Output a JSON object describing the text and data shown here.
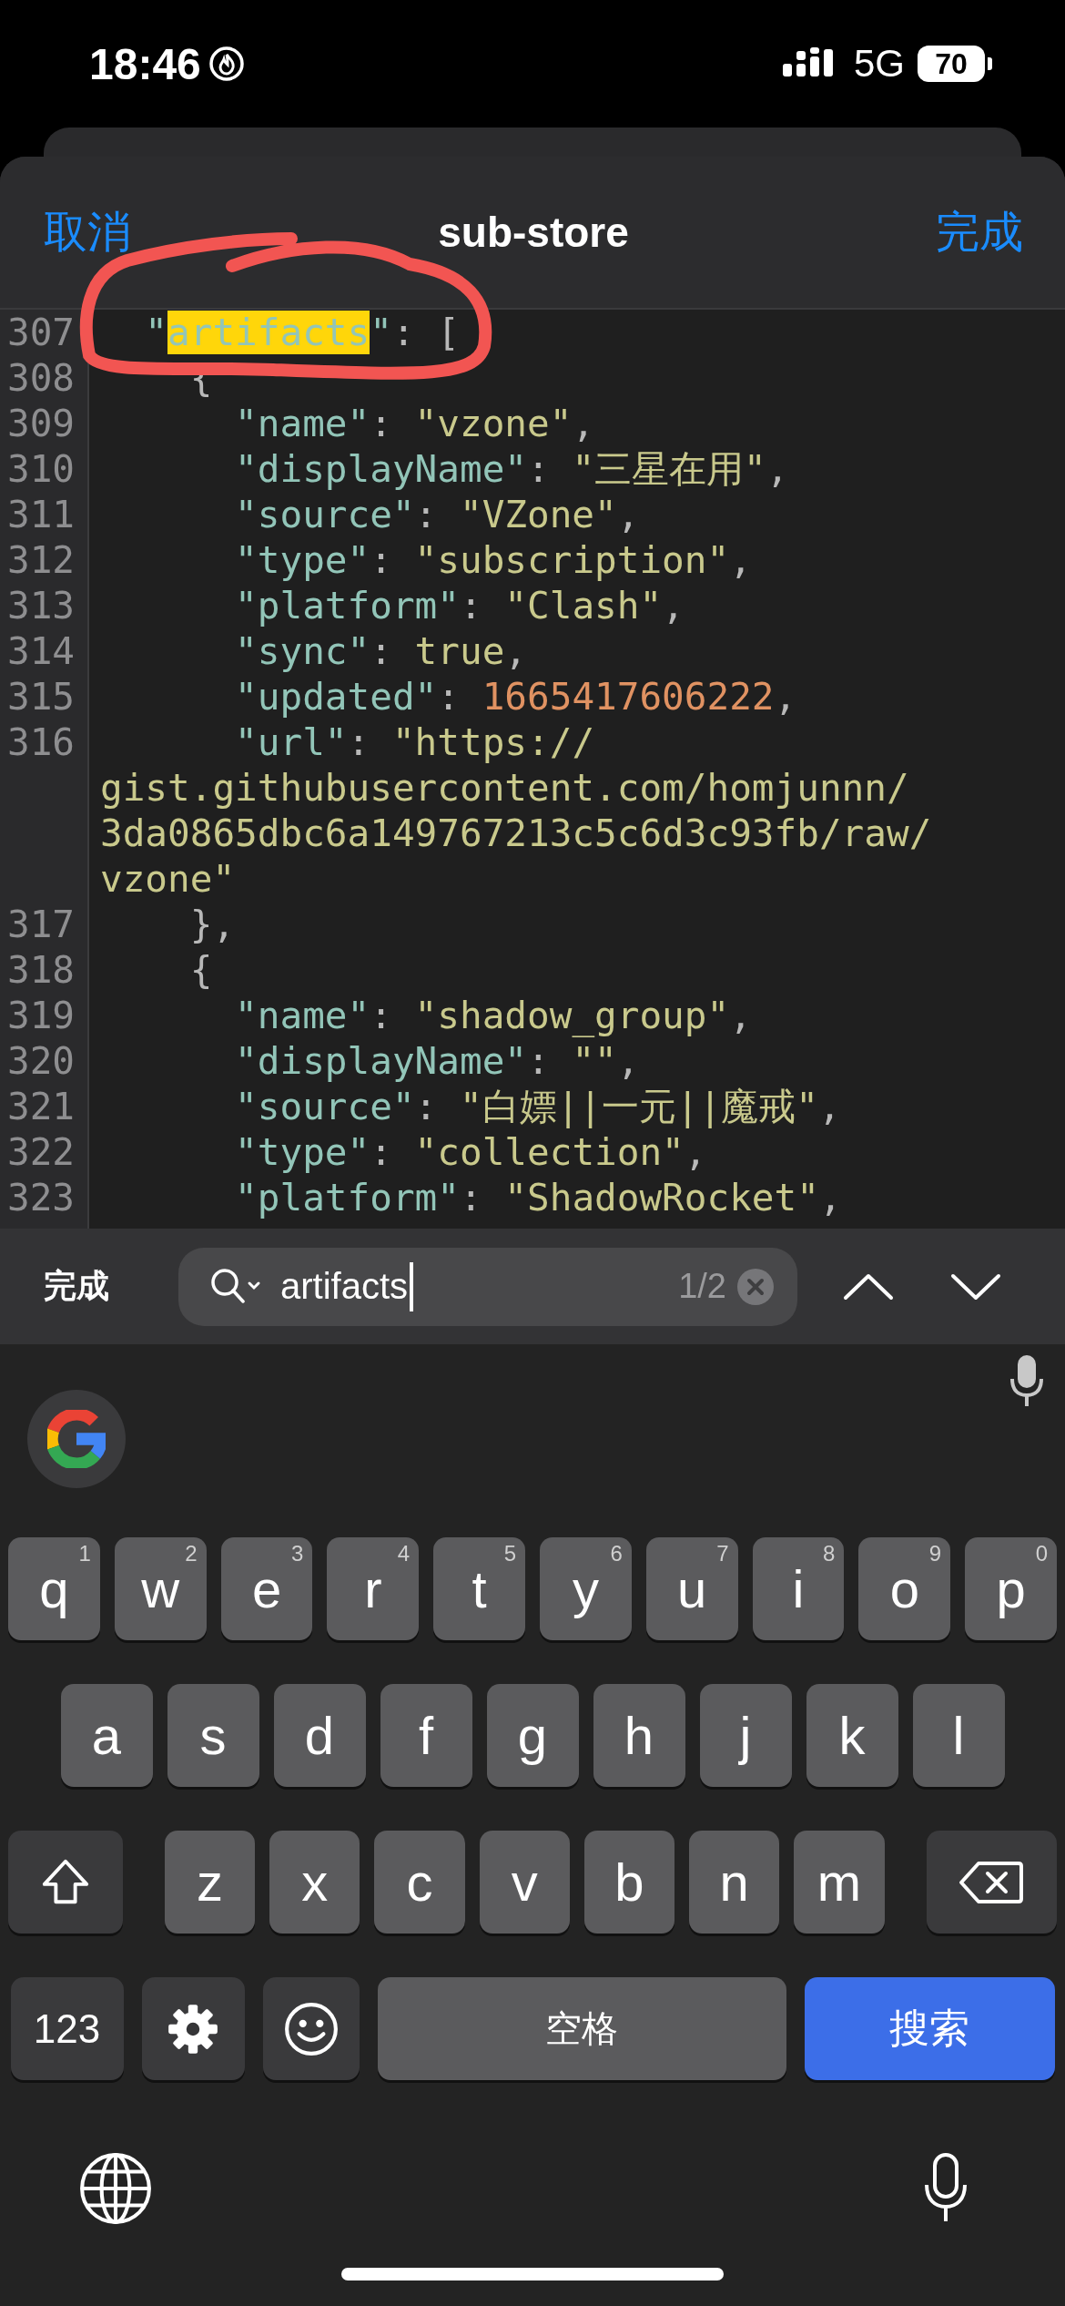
{
  "status_bar": {
    "time": "18:46",
    "network": "5G",
    "battery": "70"
  },
  "sheet": {
    "cancel": "取消",
    "title": "sub-store",
    "done": "完成"
  },
  "editor": {
    "lines": [
      {
        "number": "307",
        "tokens": [
          {
            "kind": "key",
            "text": "  \""
          },
          {
            "kind": "match",
            "text": "artifacts"
          },
          {
            "kind": "key",
            "text": "\""
          },
          {
            "kind": "punct",
            "text": ": ["
          }
        ]
      },
      {
        "number": "308",
        "tokens": [
          {
            "kind": "punct",
            "text": "    {"
          }
        ]
      },
      {
        "number": "309",
        "tokens": [
          {
            "kind": "key",
            "text": "      \"name\""
          },
          {
            "kind": "punct",
            "text": ": "
          },
          {
            "kind": "str",
            "text": "\"vzone\""
          },
          {
            "kind": "punct",
            "text": ","
          }
        ]
      },
      {
        "number": "310",
        "tokens": [
          {
            "kind": "key",
            "text": "      \"displayName\""
          },
          {
            "kind": "punct",
            "text": ": "
          },
          {
            "kind": "str",
            "text": "\"三星在用\""
          },
          {
            "kind": "punct",
            "text": ","
          }
        ]
      },
      {
        "number": "311",
        "tokens": [
          {
            "kind": "key",
            "text": "      \"source\""
          },
          {
            "kind": "punct",
            "text": ": "
          },
          {
            "kind": "str",
            "text": "\"VZone\""
          },
          {
            "kind": "punct",
            "text": ","
          }
        ]
      },
      {
        "number": "312",
        "tokens": [
          {
            "kind": "key",
            "text": "      \"type\""
          },
          {
            "kind": "punct",
            "text": ": "
          },
          {
            "kind": "str",
            "text": "\"subscription\""
          },
          {
            "kind": "punct",
            "text": ","
          }
        ]
      },
      {
        "number": "313",
        "tokens": [
          {
            "kind": "key",
            "text": "      \"platform\""
          },
          {
            "kind": "punct",
            "text": ": "
          },
          {
            "kind": "str",
            "text": "\"Clash\""
          },
          {
            "kind": "punct",
            "text": ","
          }
        ]
      },
      {
        "number": "314",
        "tokens": [
          {
            "kind": "key",
            "text": "      \"sync\""
          },
          {
            "kind": "punct",
            "text": ": "
          },
          {
            "kind": "bool",
            "text": "true"
          },
          {
            "kind": "punct",
            "text": ","
          }
        ]
      },
      {
        "number": "315",
        "tokens": [
          {
            "kind": "key",
            "text": "      \"updated\""
          },
          {
            "kind": "punct",
            "text": ": "
          },
          {
            "kind": "num",
            "text": "1665417606222"
          },
          {
            "kind": "punct",
            "text": ","
          }
        ]
      },
      {
        "number": "316",
        "tokens": [
          {
            "kind": "key",
            "text": "      \"url\""
          },
          {
            "kind": "punct",
            "text": ": "
          },
          {
            "kind": "str",
            "text": "\"https://"
          }
        ]
      },
      {
        "tokens": [
          {
            "kind": "str",
            "text": "gist.githubusercontent.com/homjunnn/"
          }
        ]
      },
      {
        "tokens": [
          {
            "kind": "str",
            "text": "3da0865dbc6a149767213c5c6d3c93fb/raw/"
          }
        ]
      },
      {
        "tokens": [
          {
            "kind": "str",
            "text": "vzone\""
          }
        ]
      },
      {
        "number": "317",
        "tokens": [
          {
            "kind": "punct",
            "text": "    },"
          }
        ]
      },
      {
        "number": "318",
        "tokens": [
          {
            "kind": "punct",
            "text": "    {"
          }
        ]
      },
      {
        "number": "319",
        "tokens": [
          {
            "kind": "key",
            "text": "      \"name\""
          },
          {
            "kind": "punct",
            "text": ": "
          },
          {
            "kind": "str",
            "text": "\"shadow_group\""
          },
          {
            "kind": "punct",
            "text": ","
          }
        ]
      },
      {
        "number": "320",
        "tokens": [
          {
            "kind": "key",
            "text": "      \"displayName\""
          },
          {
            "kind": "punct",
            "text": ": "
          },
          {
            "kind": "str",
            "text": "\"\""
          },
          {
            "kind": "punct",
            "text": ","
          }
        ]
      },
      {
        "number": "321",
        "tokens": [
          {
            "kind": "key",
            "text": "      \"source\""
          },
          {
            "kind": "punct",
            "text": ": "
          },
          {
            "kind": "str",
            "text": "\"白嫖||一元||魔戒\""
          },
          {
            "kind": "punct",
            "text": ","
          }
        ]
      },
      {
        "number": "322",
        "tokens": [
          {
            "kind": "key",
            "text": "      \"type\""
          },
          {
            "kind": "punct",
            "text": ": "
          },
          {
            "kind": "str",
            "text": "\"collection\""
          },
          {
            "kind": "punct",
            "text": ","
          }
        ]
      },
      {
        "number": "323",
        "tokens": [
          {
            "kind": "key",
            "text": "      \"platform\""
          },
          {
            "kind": "punct",
            "text": ": "
          },
          {
            "kind": "str",
            "text": "\"ShadowRocket\""
          },
          {
            "kind": "punct",
            "text": ","
          }
        ]
      }
    ]
  },
  "find_bar": {
    "done": "完成",
    "query": "artifacts",
    "count": "1/2"
  },
  "keyboard": {
    "rows": [
      {
        "keys": [
          {
            "kind": "letter",
            "label": "q",
            "hint": "1"
          },
          {
            "kind": "letter",
            "label": "w",
            "hint": "2"
          },
          {
            "kind": "letter",
            "label": "e",
            "hint": "3"
          },
          {
            "kind": "letter",
            "label": "r",
            "hint": "4"
          },
          {
            "kind": "letter",
            "label": "t",
            "hint": "5"
          },
          {
            "kind": "letter",
            "label": "y",
            "hint": "6"
          },
          {
            "kind": "letter",
            "label": "u",
            "hint": "7"
          },
          {
            "kind": "letter",
            "label": "i",
            "hint": "8"
          },
          {
            "kind": "letter",
            "label": "o",
            "hint": "9"
          },
          {
            "kind": "letter",
            "label": "p",
            "hint": "0"
          }
        ]
      },
      {
        "keys": [
          {
            "kind": "letter",
            "label": "a"
          },
          {
            "kind": "letter",
            "label": "s"
          },
          {
            "kind": "letter",
            "label": "d"
          },
          {
            "kind": "letter",
            "label": "f"
          },
          {
            "kind": "letter",
            "label": "g"
          },
          {
            "kind": "letter",
            "label": "h"
          },
          {
            "kind": "letter",
            "label": "j"
          },
          {
            "kind": "letter",
            "label": "k"
          },
          {
            "kind": "letter",
            "label": "l"
          }
        ]
      },
      {
        "keys": [
          {
            "kind": "shift"
          },
          {
            "kind": "letter",
            "label": "z"
          },
          {
            "kind": "letter",
            "label": "x"
          },
          {
            "kind": "letter",
            "label": "c"
          },
          {
            "kind": "letter",
            "label": "v"
          },
          {
            "kind": "letter",
            "label": "b"
          },
          {
            "kind": "letter",
            "label": "n"
          },
          {
            "kind": "letter",
            "label": "m"
          },
          {
            "kind": "delete"
          }
        ]
      },
      {
        "keys": [
          {
            "kind": "mode",
            "label": "123"
          },
          {
            "kind": "settings"
          },
          {
            "kind": "emoji"
          },
          {
            "kind": "space",
            "label": "空格"
          },
          {
            "kind": "search",
            "label": "搜索"
          }
        ]
      }
    ]
  }
}
